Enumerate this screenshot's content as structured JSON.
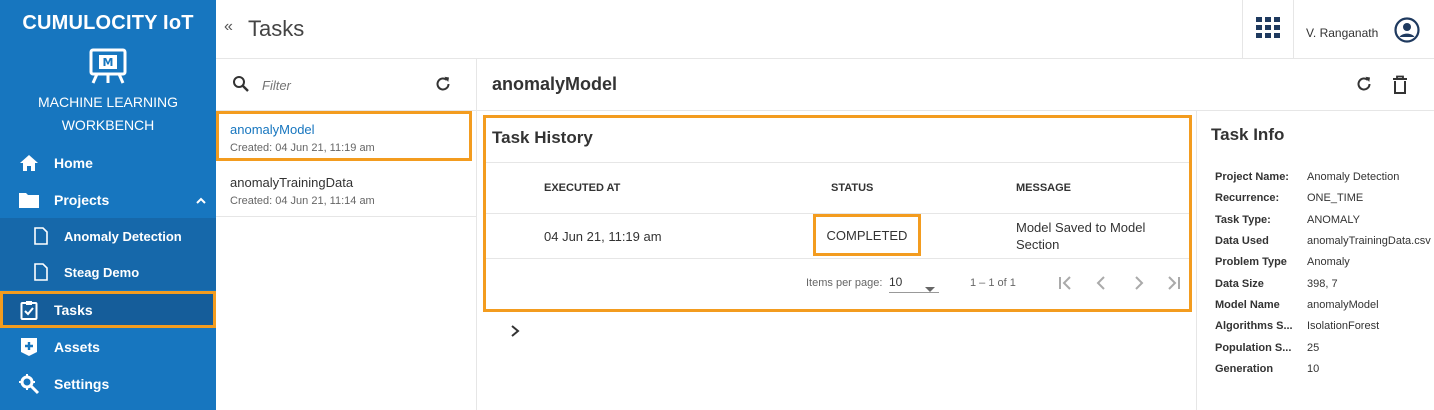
{
  "sidebar": {
    "brand": "CUMULOCITY IoT",
    "app_name_line1": "MACHINE LEARNING",
    "app_name_line2": "WORKBENCH",
    "items": [
      {
        "label": "Home"
      },
      {
        "label": "Projects"
      },
      {
        "label": "Anomaly Detection"
      },
      {
        "label": "Steag Demo"
      },
      {
        "label": "Tasks"
      },
      {
        "label": "Assets"
      },
      {
        "label": "Settings"
      }
    ]
  },
  "header": {
    "collapse_glyph": "«",
    "title": "Tasks",
    "user_name": "V. Ranganath"
  },
  "list": {
    "filter_placeholder": "Filter",
    "items": [
      {
        "name": "anomalyModel",
        "created": "Created: 04 Jun 21, 11:19 am"
      },
      {
        "name": "anomalyTrainingData",
        "created": "Created: 04 Jun 21, 11:14 am"
      }
    ]
  },
  "detail": {
    "title": "anomalyModel",
    "history": {
      "title": "Task History",
      "columns": [
        "EXECUTED AT",
        "STATUS",
        "MESSAGE"
      ],
      "rows": [
        {
          "executed_at": "04 Jun 21, 11:19 am",
          "status": "COMPLETED",
          "message_line1": "Model Saved to Model",
          "message_line2": "Section"
        }
      ],
      "pager": {
        "items_per_page_label": "Items per page:",
        "items_per_page": "10",
        "range": "1 – 1 of 1"
      }
    },
    "info": {
      "title": "Task Info",
      "rows": [
        {
          "label": "Project Name:",
          "value": "Anomaly Detection"
        },
        {
          "label": "Recurrence:",
          "value": "ONE_TIME"
        },
        {
          "label": "Task Type:",
          "value": "ANOMALY"
        },
        {
          "label": "Data Used",
          "value": "anomalyTrainingData.csv"
        },
        {
          "label": "Problem Type",
          "value": "Anomaly"
        },
        {
          "label": "Data Size",
          "value": "398, 7"
        },
        {
          "label": "Model Name",
          "value": "anomalyModel"
        },
        {
          "label": "Algorithms S...",
          "value": "IsolationForest"
        },
        {
          "label": "Population S...",
          "value": "25"
        },
        {
          "label": "Generation",
          "value": "10"
        }
      ]
    }
  },
  "colors": {
    "sidebar": "#1776bf",
    "highlight": "#f39c1f",
    "link": "#1776bf"
  },
  "icons": [
    "home-icon",
    "folder-icon",
    "file-icon",
    "clipboard-check-icon",
    "plus-box-icon",
    "settings-icon",
    "apps-grid-icon",
    "user-circle-icon",
    "search-icon",
    "refresh-icon",
    "trash-icon",
    "chevron-right-icon",
    "chevron-up-icon",
    "first-page-icon",
    "prev-page-icon",
    "next-page-icon",
    "last-page-icon",
    "dropdown-arrow-icon"
  ]
}
